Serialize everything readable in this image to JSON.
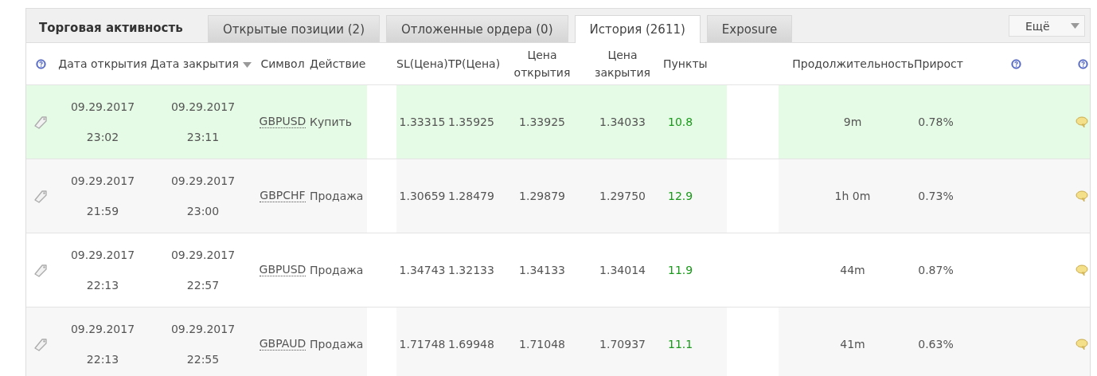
{
  "title": "Торговая активность",
  "tabs": [
    {
      "label": "Открытые позиции (2)",
      "selected": false
    },
    {
      "label": "Отложенные ордера (0)",
      "selected": false
    },
    {
      "label": "История (2611)",
      "selected": true
    },
    {
      "label": "Exposure",
      "selected": false
    }
  ],
  "more_button": "Ещё",
  "columns": [
    {
      "label": "Дата открытия",
      "sorted": false
    },
    {
      "label": "Дата закрытия",
      "sorted": true
    },
    {
      "label": "Символ",
      "sorted": false
    },
    {
      "label": "Действие",
      "sorted": false
    },
    {
      "label": "SL(Цена)",
      "sorted": false
    },
    {
      "label": "TP(Цена)",
      "sorted": false
    },
    {
      "label": "Цена открытия",
      "sorted": false
    },
    {
      "label": "Цена закрытия",
      "sorted": false
    },
    {
      "label": "Пункты",
      "sorted": false
    },
    {
      "label": "Продолжительность",
      "sorted": false
    },
    {
      "label": "Прирост",
      "sorted": false
    }
  ],
  "rows": [
    {
      "highlighted": true,
      "open_date": "09.29.2017",
      "open_time": "23:02",
      "close_date": "09.29.2017",
      "close_time": "23:11",
      "symbol": "GBPUSD",
      "action": "Купить",
      "sl": "1.33315",
      "tp": "1.35925",
      "open_price": "1.33925",
      "close_price": "1.34033",
      "points": "10.8",
      "duration": "9m",
      "growth": "0.78%"
    },
    {
      "highlighted": false,
      "open_date": "09.29.2017",
      "open_time": "21:59",
      "close_date": "09.29.2017",
      "close_time": "23:00",
      "symbol": "GBPCHF",
      "action": "Продажа",
      "sl": "1.30659",
      "tp": "1.28479",
      "open_price": "1.29879",
      "close_price": "1.29750",
      "points": "12.9",
      "duration": "1h 0m",
      "growth": "0.73%"
    },
    {
      "highlighted": false,
      "open_date": "09.29.2017",
      "open_time": "22:13",
      "close_date": "09.29.2017",
      "close_time": "22:57",
      "symbol": "GBPUSD",
      "action": "Продажа",
      "sl": "1.34743",
      "tp": "1.32133",
      "open_price": "1.34133",
      "close_price": "1.34014",
      "points": "11.9",
      "duration": "44m",
      "growth": "0.87%"
    },
    {
      "highlighted": false,
      "open_date": "09.29.2017",
      "open_time": "22:13",
      "close_date": "09.29.2017",
      "close_time": "22:55",
      "symbol": "GBPAUD",
      "action": "Продажа",
      "sl": "1.71748",
      "tp": "1.69948",
      "open_price": "1.71048",
      "close_price": "1.70937",
      "points": "11.1",
      "duration": "41m",
      "growth": "0.63%"
    }
  ]
}
